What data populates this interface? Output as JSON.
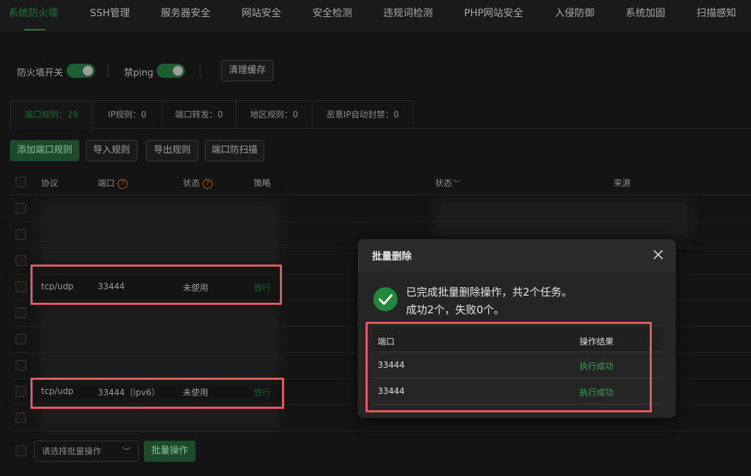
{
  "nav": {
    "tabs": [
      "系统防火墙",
      "SSH管理",
      "服务器安全",
      "网站安全",
      "安全检测",
      "违规词检测",
      "PHP网站安全",
      "入侵防御",
      "系统加固",
      "扫描感知"
    ],
    "active_index": 0
  },
  "toolbar": {
    "firewall_label": "防火墙开关",
    "firewall_on": true,
    "ping_label": "禁ping",
    "ping_on": true,
    "clear_cache": "清理缓存"
  },
  "subtabs": [
    {
      "label": "端口规则：29",
      "active": true
    },
    {
      "label": "IP规则：0",
      "active": false
    },
    {
      "label": "端口转发：0",
      "active": false
    },
    {
      "label": "地区规则：0",
      "active": false
    },
    {
      "label": "恶意IP自动封禁：0",
      "active": false
    }
  ],
  "actions": {
    "add_rule": "添加端口规则",
    "import": "导入规则",
    "export": "导出规则",
    "scan_protect": "端口防扫描"
  },
  "table": {
    "headers": {
      "protocol": "协议",
      "port": "端口",
      "status": "状态",
      "policy": "策略",
      "status2": "状态",
      "source": "来源"
    },
    "rows": [
      {
        "protocol": "tcp/udp",
        "port": "33444",
        "status": "未使用",
        "policy": "放行"
      },
      {
        "protocol": "tcp/udp",
        "port": "33444（ipv6）",
        "status": "未使用",
        "policy": "放行"
      }
    ]
  },
  "bottom": {
    "select_placeholder": "请选择批量操作",
    "batch_button": "批量操作"
  },
  "dialog": {
    "title": "批量删除",
    "message_line1": "已完成批量删除操作，共2个任务。",
    "message_line2": "成功2个，失败0个。",
    "col_port": "端口",
    "col_result": "操作结果",
    "results": [
      {
        "port": "33444",
        "result": "执行成功"
      },
      {
        "port": "33444",
        "result": "执行成功"
      }
    ]
  },
  "colors": {
    "accent": "#1e7a3e",
    "success": "#3ba55c",
    "highlight": "#e45a5e"
  }
}
